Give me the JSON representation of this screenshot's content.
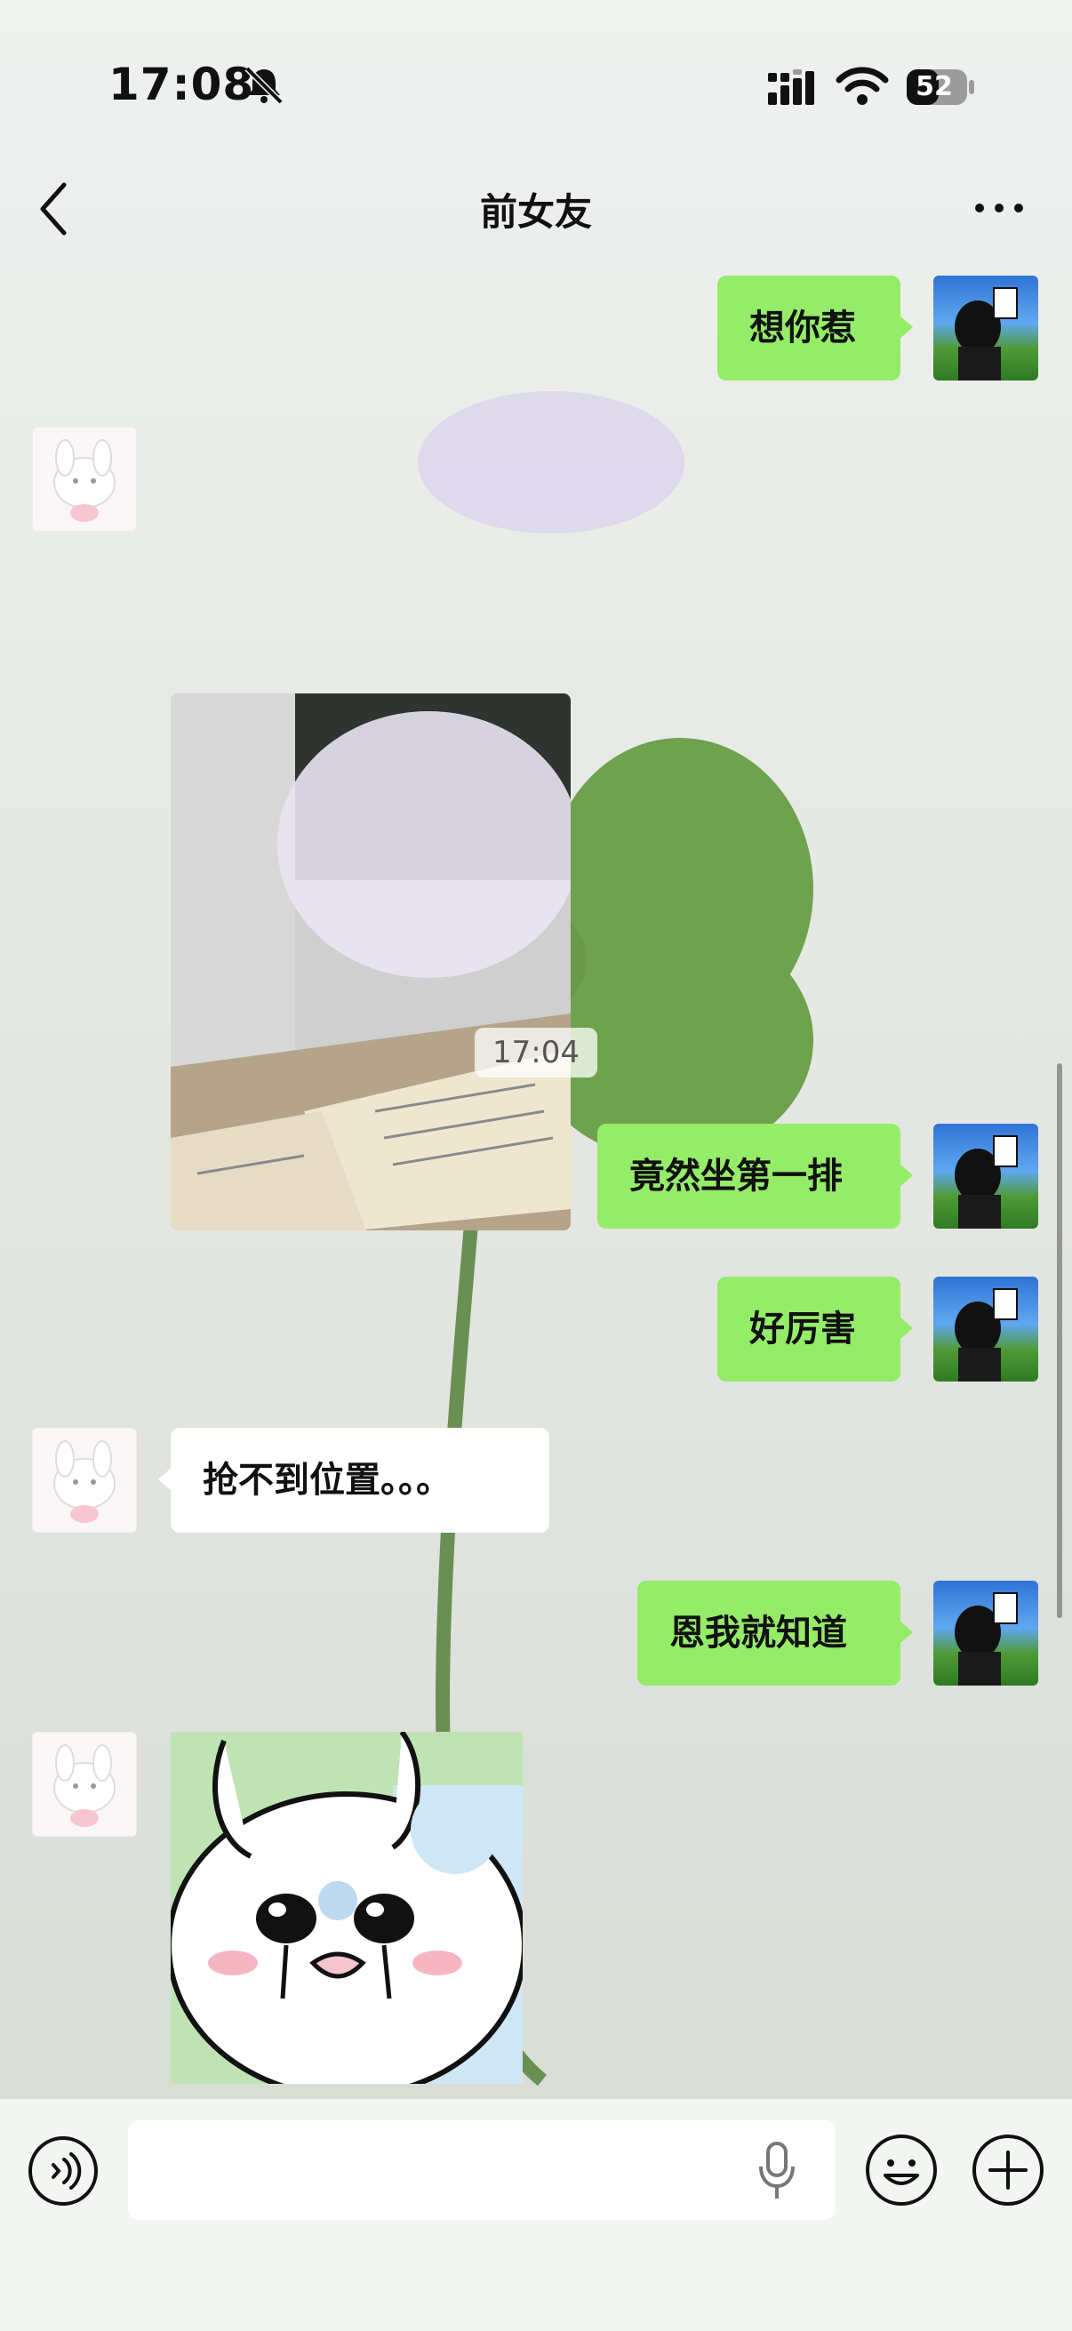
{
  "status_bar": {
    "time": "17:08",
    "battery": "52"
  },
  "nav": {
    "title": "前女友"
  },
  "messages": [
    {
      "side": "me",
      "text": "想你惹"
    },
    {
      "side": "other",
      "type": "image"
    },
    {
      "type": "timestamp",
      "text": "17:04"
    },
    {
      "side": "me",
      "text": "竟然坐第一排"
    },
    {
      "side": "me",
      "text": "好厉害"
    },
    {
      "side": "other",
      "text": "抢不到位置。。。"
    },
    {
      "side": "me",
      "text": "恩我就知道"
    },
    {
      "side": "other",
      "type": "sticker"
    }
  ],
  "input": {
    "value": "",
    "placeholder": ""
  },
  "colors": {
    "my_bubble": "#95ec69",
    "other_bubble": "#ffffff",
    "background": "#e9ecea"
  },
  "icons": [
    "bell-muted-icon",
    "signal-icon",
    "wifi-icon",
    "battery-icon",
    "back-chevron-icon",
    "more-dots-icon",
    "voice-icon",
    "microphone-icon",
    "emoji-icon",
    "plus-icon"
  ]
}
